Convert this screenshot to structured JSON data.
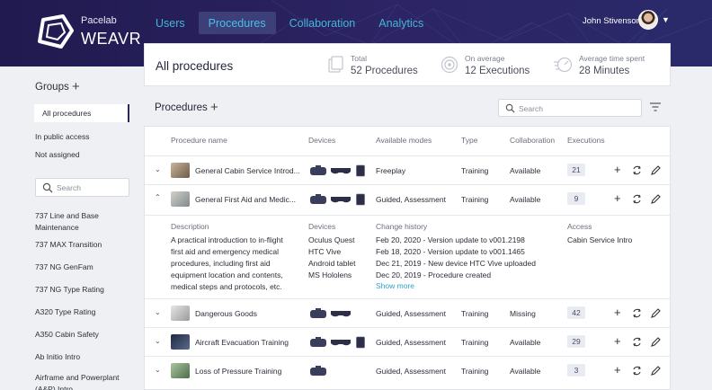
{
  "header": {
    "brand_top": "Pacelab",
    "brand_main": "WEAVR",
    "tabs": [
      {
        "label": "Users",
        "active": false
      },
      {
        "label": "Procedures",
        "active": true
      },
      {
        "label": "Collaboration",
        "active": false
      },
      {
        "label": "Analytics",
        "active": false
      }
    ],
    "user_name": "John Stivenson",
    "accent_color": "#46c2e6"
  },
  "sidebar": {
    "title": "Groups",
    "groups": [
      "All procedures",
      "In public access",
      "Not assigned"
    ],
    "search_placeholder": "Search",
    "items": [
      "737 Line and Base Maintenance",
      "737 MAX Transition",
      "737 NG GenFam",
      "737 NG Type Rating",
      "A320 Type Rating",
      "A350 Cabin Safety",
      "Ab Initio Intro",
      "Airframe and Powerplant (A&P) Intro"
    ]
  },
  "summary": {
    "title": "All procedures",
    "stats": [
      {
        "label": "Total",
        "value": "52 Procedures",
        "icon": "procedures-icon"
      },
      {
        "label": "On average",
        "value": "12 Executions",
        "icon": "target-icon"
      },
      {
        "label": "Average time spent",
        "value": "28 Minutes",
        "icon": "speed-icon"
      }
    ]
  },
  "procedures": {
    "title": "Procedures",
    "search_placeholder": "Search",
    "columns": [
      "Procedure name",
      "Devices",
      "Available modes",
      "Type",
      "Collaboration",
      "Executions"
    ],
    "rows": [
      {
        "name": "General Cabin Service Introd...",
        "devices": [
          "vr-headset",
          "ar-glasses",
          "tablet"
        ],
        "modes": "Freeplay",
        "type": "Training",
        "collaboration": "Available",
        "executions": "21",
        "expanded": false
      },
      {
        "name": "General First Aid and Medic...",
        "devices": [
          "vr-headset",
          "ar-glasses",
          "tablet"
        ],
        "modes": "Guided, Assessment",
        "type": "Training",
        "collaboration": "Available",
        "executions": "9",
        "expanded": true
      },
      {
        "name": "Dangerous Goods",
        "devices": [
          "vr-headset",
          "ar-glasses"
        ],
        "modes": "Guided, Assessment",
        "type": "Training",
        "collaboration": "Missing",
        "executions": "42",
        "expanded": false
      },
      {
        "name": "Aircraft Evacuation Training",
        "devices": [
          "vr-headset",
          "ar-glasses",
          "tablet"
        ],
        "modes": "Guided, Assessment",
        "type": "Training",
        "collaboration": "Available",
        "executions": "29",
        "expanded": false
      },
      {
        "name": "Loss of Pressure Training",
        "devices": [
          "vr-headset"
        ],
        "modes": "Guided, Assessment",
        "type": "Training",
        "collaboration": "Available",
        "executions": "3",
        "expanded": false
      }
    ],
    "detail": {
      "description_label": "Description",
      "description": [
        "A practical introduction to in-flight",
        "first aid and emergency medical",
        "procedures, including first aid",
        "equipment location and contents,",
        "medical steps and protocols, etc."
      ],
      "devices_label": "Devices",
      "devices": [
        "Oculus Quest",
        "HTC Vive",
        "Android tablet",
        "MS Hololens"
      ],
      "history_label": "Change history",
      "history": [
        "Feb 20, 2020 - Version update to v001.2198",
        "Feb 18, 2020 - Version update to v001.1465",
        "Dec 21, 2019 - New device HTC Vive uploaded",
        "Dec 20, 2019 - Procedure created"
      ],
      "show_more": "Show more",
      "access_label": "Access",
      "access": "Cabin Service Intro"
    }
  }
}
